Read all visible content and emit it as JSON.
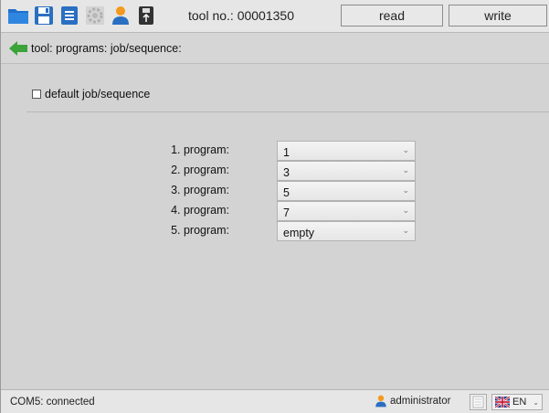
{
  "toolbar": {
    "icons": [
      "folder-icon",
      "save-icon",
      "print-icon",
      "settings-icon",
      "user-icon",
      "usb-icon"
    ],
    "tool_no": "tool no.: 00001350",
    "read_label": "read",
    "write_label": "write"
  },
  "breadcrumb": {
    "text": "tool: programs: job/sequence:"
  },
  "options": {
    "default_job_label": "default job/sequence",
    "default_job_checked": false
  },
  "programs": [
    {
      "label": "1. program:",
      "value": "1"
    },
    {
      "label": "2. program:",
      "value": "3"
    },
    {
      "label": "3. program:",
      "value": "5"
    },
    {
      "label": "4. program:",
      "value": "7"
    },
    {
      "label": "5. program:",
      "value": "empty"
    }
  ],
  "statusbar": {
    "connection": "COM5: connected",
    "user": "administrator",
    "language": "EN"
  },
  "colors": {
    "accent_blue": "#2f7fd3",
    "back_arrow_green": "#3aa43a",
    "user_orange": "#f39a1e"
  }
}
